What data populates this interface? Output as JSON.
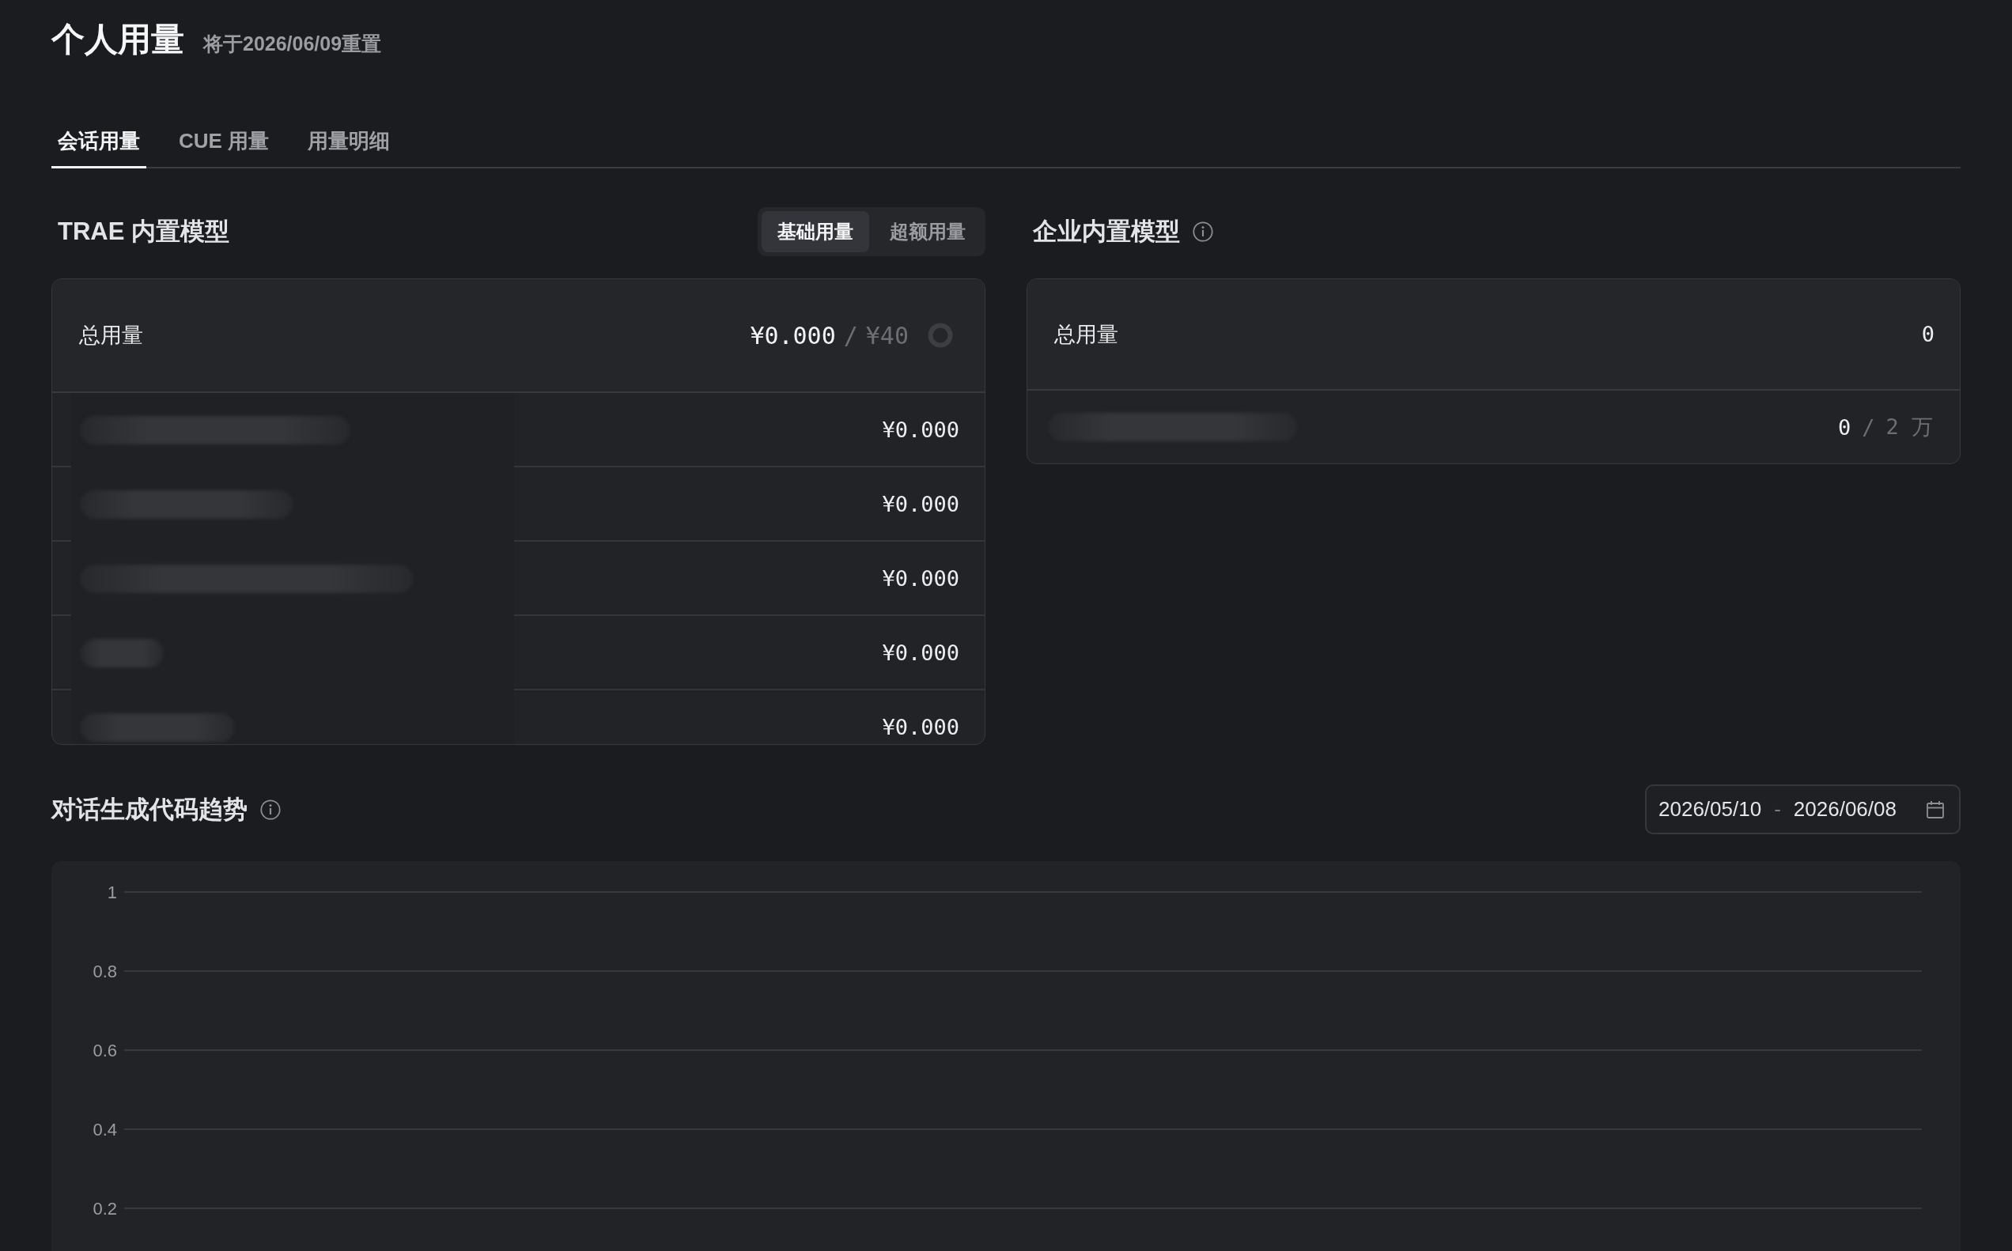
{
  "header": {
    "title": "个人用量",
    "subtitle": "将于2026/06/09重置"
  },
  "tabs": [
    {
      "label": "会话用量",
      "selected": true
    },
    {
      "label": "CUE 用量",
      "selected": false
    },
    {
      "label": "用量明细",
      "selected": false
    }
  ],
  "trae_models": {
    "title": "TRAE 内置模型",
    "modes": [
      {
        "label": "基础用量",
        "selected": true
      },
      {
        "label": "超额用量",
        "selected": false
      }
    ],
    "total": {
      "label": "总用量",
      "used": "¥0.000",
      "separator": "/",
      "limit": "¥40"
    },
    "rows": [
      {
        "value": "¥0.000"
      },
      {
        "value": "¥0.000"
      },
      {
        "value": "¥0.000"
      },
      {
        "value": "¥0.000"
      },
      {
        "value": "¥0.000"
      }
    ]
  },
  "enterprise_models": {
    "title": "企业内置模型",
    "total": {
      "label": "总用量",
      "value": "0"
    },
    "rows": [
      {
        "used": "0",
        "separator": "/",
        "limit": "2 万"
      }
    ]
  },
  "trend": {
    "title": "对话生成代码趋势",
    "date_range": {
      "start": "2026/05/10",
      "separator": "-",
      "end": "2026/06/08"
    },
    "chart_data": {
      "type": "line",
      "categories": [
        null,
        null,
        null,
        null,
        null,
        null,
        null,
        null,
        null,
        null,
        null,
        null,
        null,
        null,
        null,
        null,
        null,
        null,
        null,
        null,
        null,
        null,
        null,
        null,
        null,
        null,
        null,
        null,
        null,
        null
      ],
      "ylim": [
        0.2,
        1
      ],
      "yticks": [
        0.2,
        0.4,
        0.6,
        0.8,
        1
      ],
      "grid": true
    }
  }
}
